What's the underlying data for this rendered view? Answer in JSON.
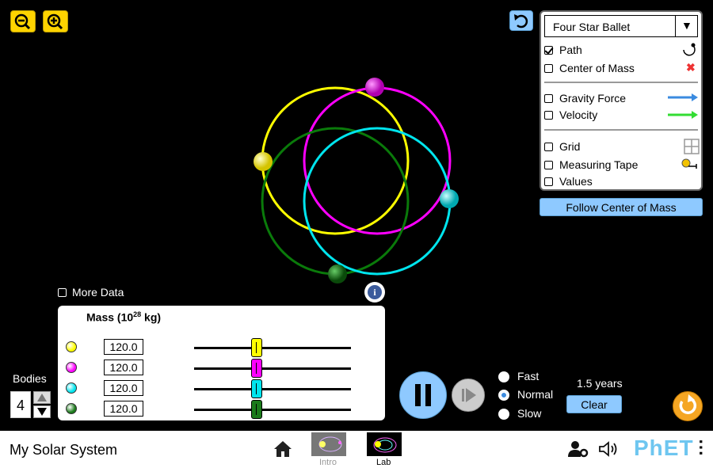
{
  "zoom": {
    "out_icon": "zoom-out-icon",
    "in_icon": "zoom-in-icon"
  },
  "controls": {
    "preset_value": "Four Star Ballet",
    "path_label": "Path",
    "path_checked": true,
    "center_of_mass_label": "Center of Mass",
    "gravity_force_label": "Gravity Force",
    "velocity_label": "Velocity",
    "grid_label": "Grid",
    "measuring_tape_label": "Measuring Tape",
    "values_label": "Values",
    "follow_button": "Follow Center of Mass",
    "colors": {
      "gravity_arrow": "#3a8be0",
      "velocity_arrow": "#33dd33",
      "com_x": "#e33"
    }
  },
  "bodies_colors": [
    "#ffff00",
    "#ff00ff",
    "#00e5ee",
    "#0a7a0a"
  ],
  "more_data_label": "More Data",
  "mass_panel": {
    "title": "Mass (10",
    "exp": "28",
    "unit": " kg)",
    "rows": [
      {
        "value": "120.0",
        "color": "#ffff00",
        "slider": 0.4
      },
      {
        "value": "120.0",
        "color": "#ff00ff",
        "slider": 0.4
      },
      {
        "value": "120.0",
        "color": "#00e5ee",
        "slider": 0.4
      },
      {
        "value": "120.0",
        "color": "#1a7a1a",
        "slider": 0.4
      }
    ]
  },
  "bodies": {
    "label": "Bodies",
    "count": "4"
  },
  "speed": {
    "options": [
      "Fast",
      "Normal",
      "Slow"
    ],
    "selected": "Normal"
  },
  "time": {
    "elapsed": "1.5 years",
    "clear_label": "Clear"
  },
  "nav": {
    "title": "My Solar System",
    "screens": [
      {
        "label": "Intro"
      },
      {
        "label": "Lab"
      }
    ],
    "brand": "PhET"
  }
}
